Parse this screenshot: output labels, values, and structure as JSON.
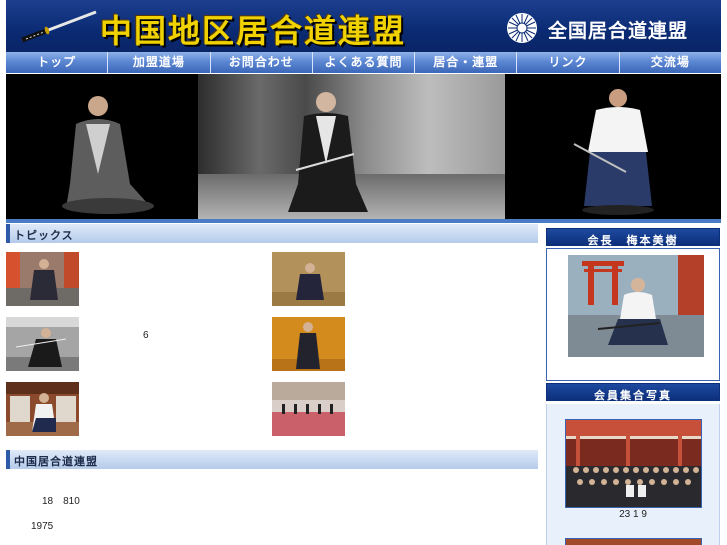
{
  "header": {
    "site_title": "中国地区居合道連盟",
    "federation_link": "全国居合道連盟"
  },
  "nav": {
    "items": [
      "トップ",
      "加盟道場",
      "お問合わせ",
      "よくある質問",
      "居合・連盟",
      "リンク",
      "交流場"
    ]
  },
  "topics": {
    "title": "トピックス",
    "items": [
      {
        "text": ""
      },
      {
        "text": ""
      },
      {
        "text": "6"
      },
      {
        "text": ""
      },
      {
        "text": ""
      },
      {
        "text": ""
      }
    ]
  },
  "federation_section": {
    "title": "中国居合道連盟",
    "paragraphs": [
      "18　810",
      "1975"
    ]
  },
  "sidebar": {
    "president_title": "会長　梅本美樹",
    "members_title": "会員集合写真",
    "members_caption": "23 1 9"
  }
}
